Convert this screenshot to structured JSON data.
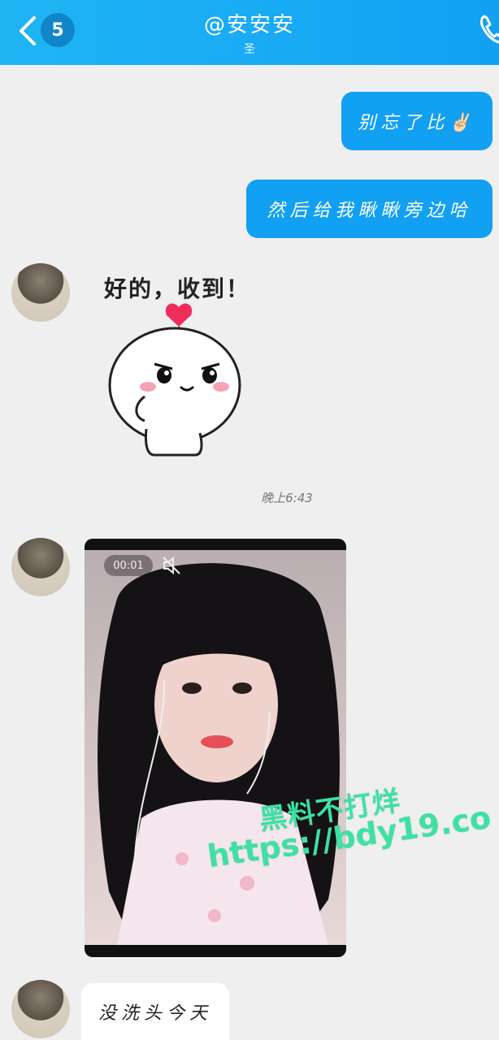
{
  "header": {
    "unread_count": "5",
    "title": "@安安安",
    "subtitle": "圣",
    "icons": {
      "back": "chevron-left-icon",
      "call": "phone-icon"
    }
  },
  "messages": [
    {
      "side": "out",
      "text": "别忘了比✌🏻"
    },
    {
      "side": "out",
      "text": "然后给我瞅瞅旁边哈"
    },
    {
      "side": "in",
      "type": "sticker",
      "text": "好的，收到！"
    },
    {
      "type": "timestamp",
      "text": "晚上6:43"
    },
    {
      "side": "in",
      "type": "video",
      "duration": "00:01",
      "muted": true
    },
    {
      "side": "in",
      "text": "没洗头今天"
    }
  ],
  "watermark": {
    "line1": "黑料不打烊",
    "line2": "https://bdy19.co"
  },
  "colors": {
    "accent": "#12a0f2",
    "header_start": "#1fb5f3",
    "badge": "#0f86c9",
    "watermark": "#3ee0a4",
    "background": "#efefef"
  }
}
